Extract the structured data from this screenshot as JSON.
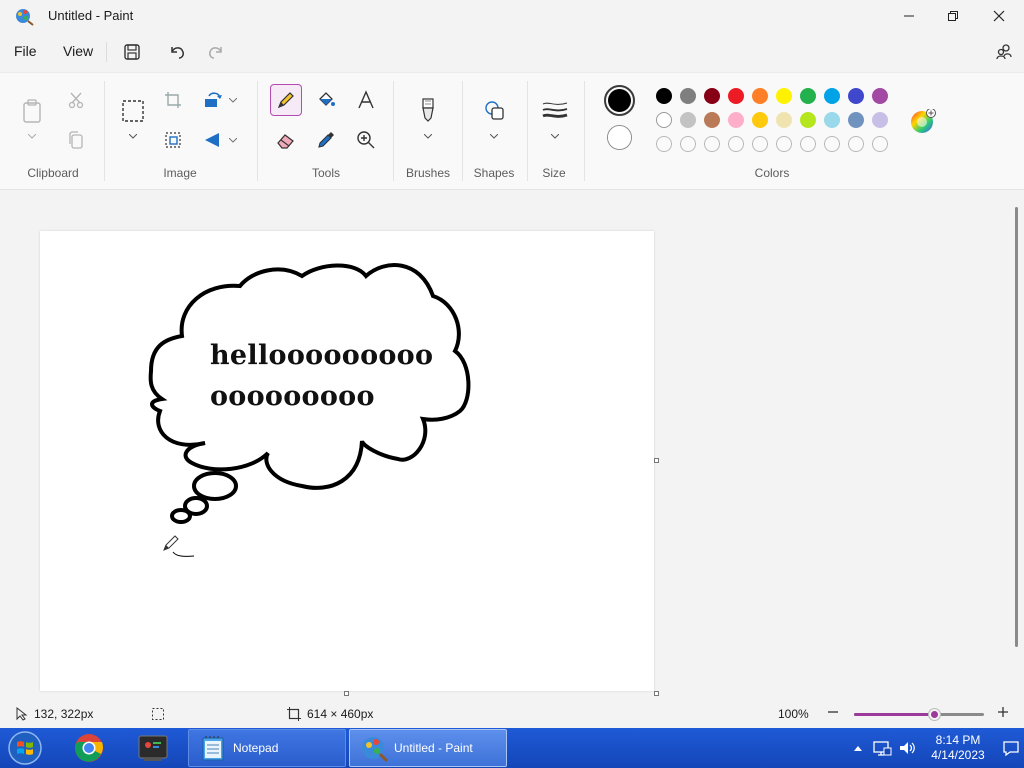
{
  "window": {
    "title": "Untitled - Paint"
  },
  "menu": {
    "file": "File",
    "view": "View"
  },
  "ribbon": {
    "groups": {
      "clipboard": "Clipboard",
      "image": "Image",
      "tools": "Tools",
      "brushes": "Brushes",
      "shapes": "Shapes",
      "size": "Size",
      "colors": "Colors"
    },
    "palette": {
      "row1": [
        "#000000",
        "#7f7f7f",
        "#880015",
        "#ed1c24",
        "#ff7f27",
        "#fff200",
        "#22b14c",
        "#00a2e8",
        "#3f48cc",
        "#a349a4"
      ],
      "row2": [
        "#ffffff",
        "#c3c3c3",
        "#b97a57",
        "#ffaec9",
        "#ffc90e",
        "#efe4b0",
        "#b5e61d",
        "#99d9ea",
        "#7092be",
        "#c8bfe7"
      ]
    },
    "color1": "#000000",
    "color2": "#ffffff"
  },
  "canvas": {
    "text_line1": "hellooooooooo",
    "text_line2": "ooooooooo"
  },
  "status": {
    "cursor_position": "132, 322px",
    "canvas_size": "614 × 460px",
    "zoom": "100%",
    "zoom_level": 0.62
  },
  "taskbar": {
    "notepad": "Notepad",
    "paint": "Untitled - Paint",
    "time": "8:14 PM",
    "date": "4/14/2023"
  }
}
